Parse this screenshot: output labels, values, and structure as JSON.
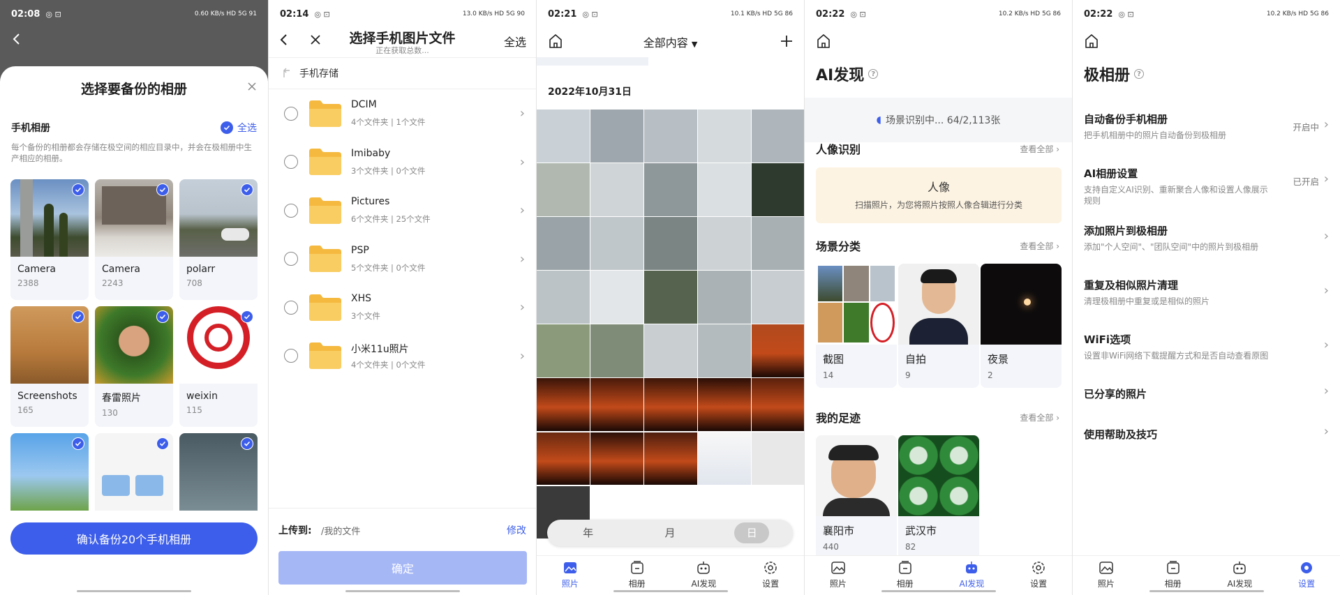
{
  "colors": {
    "accent": "#3d5eea",
    "disabled": "#a6b7f6",
    "folder": "#f7c553"
  },
  "panel1": {
    "status": {
      "time": "02:08",
      "right": "0.60 KB/s HD 5G 91"
    },
    "title": "选择要备份的相册",
    "section_label": "手机相册",
    "select_all": "全选",
    "description": "每个备份的相册都会存储在极空间的相应目录中，并会在极相册中生产相应的相册。",
    "albums": [
      {
        "name": "Camera",
        "count": "2388"
      },
      {
        "name": "Camera",
        "count": "2243"
      },
      {
        "name": "polarr",
        "count": "708"
      },
      {
        "name": "Screenshots",
        "count": "165"
      },
      {
        "name": "春雷照片",
        "count": "130"
      },
      {
        "name": "weixin",
        "count": "115"
      },
      {
        "name": "",
        "count": ""
      },
      {
        "name": "",
        "count": ""
      },
      {
        "name": "",
        "count": ""
      }
    ],
    "confirm": "确认备份20个手机相册"
  },
  "panel2": {
    "status": {
      "time": "02:14",
      "right": "13.0 KB/s HD 5G 90"
    },
    "title": "选择手机图片文件",
    "subtitle": "正在获取总数...",
    "select_all": "全选",
    "path": "手机存储",
    "folders": [
      {
        "name": "DCIM",
        "meta": "4个文件夹 | 1个文件"
      },
      {
        "name": "Imibaby",
        "meta": "3个文件夹 | 0个文件"
      },
      {
        "name": "Pictures",
        "meta": "6个文件夹 | 25个文件"
      },
      {
        "name": "PSP",
        "meta": "5个文件夹 | 0个文件"
      },
      {
        "name": "XHS",
        "meta": "3个文件"
      },
      {
        "name": "小米11u照片",
        "meta": "4个文件夹 | 0个文件"
      }
    ],
    "upload_label": "上传到:",
    "upload_path": "/我的文件",
    "modify": "修改",
    "confirm": "确定"
  },
  "panel3": {
    "status": {
      "time": "02:21",
      "right": "10.1 KB/s HD 5G 86"
    },
    "dropdown": "全部内容",
    "date": "2022年10月31日",
    "segments": [
      "年",
      "月",
      "日"
    ],
    "active_segment": 2
  },
  "tabs": [
    "照片",
    "相册",
    "AI发现",
    "设置"
  ],
  "panel4": {
    "status": {
      "time": "02:22",
      "right": "10.2 KB/s HD 5G 86"
    },
    "title": "AI发现",
    "scanning": "场景识别中... 64/2,113张",
    "face_section": "人像识别",
    "see_all": "查看全部",
    "face_title": "人像",
    "face_sub": "扫描照片，为您将照片按照人像合辑进行分类",
    "scene_section": "场景分类",
    "scenes": [
      {
        "name": "截图",
        "count": "14"
      },
      {
        "name": "自拍",
        "count": "9"
      },
      {
        "name": "夜景",
        "count": "2"
      }
    ],
    "trail_section": "我的足迹",
    "places": [
      {
        "name": "襄阳市",
        "count": "440"
      },
      {
        "name": "武汉市",
        "count": "82"
      }
    ]
  },
  "panel5": {
    "status": {
      "time": "02:22",
      "right": "10.2 KB/s HD 5G 86"
    },
    "title": "极相册",
    "settings": [
      {
        "name": "自动备份手机相册",
        "desc": "把手机相册中的照片自动备份到极相册",
        "value": "开启中"
      },
      {
        "name": "AI相册设置",
        "desc": "支持自定义AI识别、重新聚合人像和设置人像展示规则",
        "value": "已开启"
      },
      {
        "name": "添加照片到极相册",
        "desc": "添加\"个人空间\"、\"团队空间\"中的照片到极相册",
        "value": ""
      },
      {
        "name": "重复及相似照片清理",
        "desc": "清理极相册中重复或是相似的照片",
        "value": ""
      },
      {
        "name": "WiFi选项",
        "desc": "设置非WiFi网络下载提醒方式和是否自动查看原图",
        "value": ""
      },
      {
        "name": "已分享的照片",
        "desc": "",
        "value": ""
      },
      {
        "name": "使用帮助及技巧",
        "desc": "",
        "value": ""
      }
    ]
  }
}
